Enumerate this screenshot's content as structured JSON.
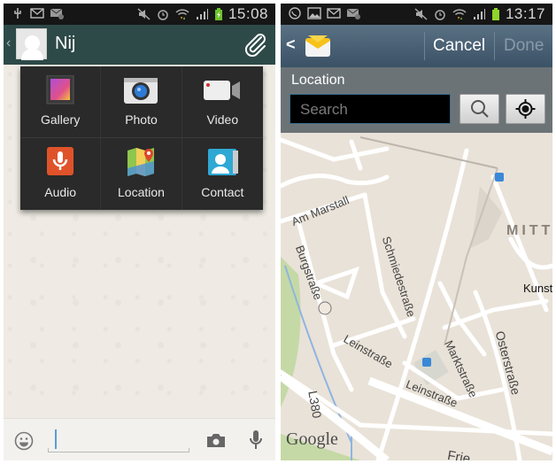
{
  "left_screen": {
    "status_bar": {
      "left_icons": [
        "usb-icon",
        "gmail-icon",
        "email-icon"
      ],
      "right_icons": [
        "mute-icon",
        "alarm-icon",
        "wifi-icon",
        "signal-icon",
        "battery-charging-icon"
      ],
      "time": "15:08"
    },
    "header": {
      "back_glyph": "‹",
      "contact_name": "Nij"
    },
    "attach_menu": {
      "items": [
        {
          "label": "Gallery",
          "icon": "gallery-icon"
        },
        {
          "label": "Photo",
          "icon": "camera-icon"
        },
        {
          "label": "Video",
          "icon": "video-camera-icon"
        },
        {
          "label": "Audio",
          "icon": "microphone-icon"
        },
        {
          "label": "Location",
          "icon": "map-pin-icon"
        },
        {
          "label": "Contact",
          "icon": "contact-card-icon"
        }
      ]
    },
    "input_bar": {
      "message_value": "",
      "icons": [
        "emoji-icon",
        "camera-icon",
        "microphone-icon"
      ]
    }
  },
  "right_screen": {
    "status_bar": {
      "left_icons": [
        "whatsapp-icon",
        "image-icon",
        "gmail-icon",
        "email-icon"
      ],
      "right_icons": [
        "mute-icon",
        "alarm-icon",
        "wifi-icon",
        "signal-icon",
        "battery-icon"
      ],
      "time": "13:17"
    },
    "header": {
      "back_glyph": "<",
      "cancel_label": "Cancel",
      "done_label": "Done"
    },
    "location_panel": {
      "title": "Location",
      "search_placeholder": "Search",
      "search_value": ""
    },
    "map": {
      "labels": [
        "Am Marstall",
        "Schmiedestraße",
        "MITT",
        "Kunst",
        "Burgstraße",
        "Leinstraße",
        "Marktstraße",
        "Osterstraße",
        "Leinstraße",
        "L380",
        "Frie"
      ],
      "attribution": "Google"
    }
  }
}
